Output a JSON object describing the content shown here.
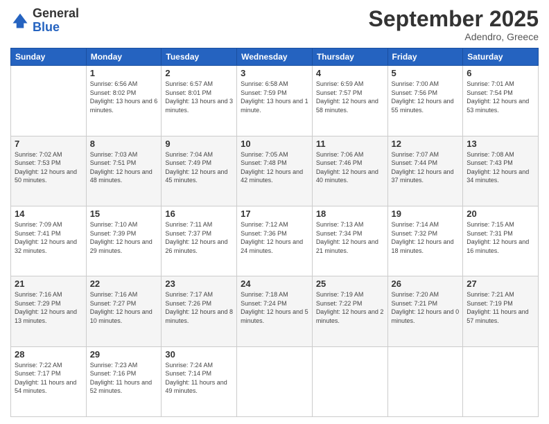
{
  "logo": {
    "general": "General",
    "blue": "Blue"
  },
  "header": {
    "month": "September 2025",
    "location": "Adendro, Greece"
  },
  "days_of_week": [
    "Sunday",
    "Monday",
    "Tuesday",
    "Wednesday",
    "Thursday",
    "Friday",
    "Saturday"
  ],
  "weeks": [
    [
      {
        "day": "",
        "sunrise": "",
        "sunset": "",
        "daylight": ""
      },
      {
        "day": "1",
        "sunrise": "Sunrise: 6:56 AM",
        "sunset": "Sunset: 8:02 PM",
        "daylight": "Daylight: 13 hours and 6 minutes."
      },
      {
        "day": "2",
        "sunrise": "Sunrise: 6:57 AM",
        "sunset": "Sunset: 8:01 PM",
        "daylight": "Daylight: 13 hours and 3 minutes."
      },
      {
        "day": "3",
        "sunrise": "Sunrise: 6:58 AM",
        "sunset": "Sunset: 7:59 PM",
        "daylight": "Daylight: 13 hours and 1 minute."
      },
      {
        "day": "4",
        "sunrise": "Sunrise: 6:59 AM",
        "sunset": "Sunset: 7:57 PM",
        "daylight": "Daylight: 12 hours and 58 minutes."
      },
      {
        "day": "5",
        "sunrise": "Sunrise: 7:00 AM",
        "sunset": "Sunset: 7:56 PM",
        "daylight": "Daylight: 12 hours and 55 minutes."
      },
      {
        "day": "6",
        "sunrise": "Sunrise: 7:01 AM",
        "sunset": "Sunset: 7:54 PM",
        "daylight": "Daylight: 12 hours and 53 minutes."
      }
    ],
    [
      {
        "day": "7",
        "sunrise": "Sunrise: 7:02 AM",
        "sunset": "Sunset: 7:53 PM",
        "daylight": "Daylight: 12 hours and 50 minutes."
      },
      {
        "day": "8",
        "sunrise": "Sunrise: 7:03 AM",
        "sunset": "Sunset: 7:51 PM",
        "daylight": "Daylight: 12 hours and 48 minutes."
      },
      {
        "day": "9",
        "sunrise": "Sunrise: 7:04 AM",
        "sunset": "Sunset: 7:49 PM",
        "daylight": "Daylight: 12 hours and 45 minutes."
      },
      {
        "day": "10",
        "sunrise": "Sunrise: 7:05 AM",
        "sunset": "Sunset: 7:48 PM",
        "daylight": "Daylight: 12 hours and 42 minutes."
      },
      {
        "day": "11",
        "sunrise": "Sunrise: 7:06 AM",
        "sunset": "Sunset: 7:46 PM",
        "daylight": "Daylight: 12 hours and 40 minutes."
      },
      {
        "day": "12",
        "sunrise": "Sunrise: 7:07 AM",
        "sunset": "Sunset: 7:44 PM",
        "daylight": "Daylight: 12 hours and 37 minutes."
      },
      {
        "day": "13",
        "sunrise": "Sunrise: 7:08 AM",
        "sunset": "Sunset: 7:43 PM",
        "daylight": "Daylight: 12 hours and 34 minutes."
      }
    ],
    [
      {
        "day": "14",
        "sunrise": "Sunrise: 7:09 AM",
        "sunset": "Sunset: 7:41 PM",
        "daylight": "Daylight: 12 hours and 32 minutes."
      },
      {
        "day": "15",
        "sunrise": "Sunrise: 7:10 AM",
        "sunset": "Sunset: 7:39 PM",
        "daylight": "Daylight: 12 hours and 29 minutes."
      },
      {
        "day": "16",
        "sunrise": "Sunrise: 7:11 AM",
        "sunset": "Sunset: 7:37 PM",
        "daylight": "Daylight: 12 hours and 26 minutes."
      },
      {
        "day": "17",
        "sunrise": "Sunrise: 7:12 AM",
        "sunset": "Sunset: 7:36 PM",
        "daylight": "Daylight: 12 hours and 24 minutes."
      },
      {
        "day": "18",
        "sunrise": "Sunrise: 7:13 AM",
        "sunset": "Sunset: 7:34 PM",
        "daylight": "Daylight: 12 hours and 21 minutes."
      },
      {
        "day": "19",
        "sunrise": "Sunrise: 7:14 AM",
        "sunset": "Sunset: 7:32 PM",
        "daylight": "Daylight: 12 hours and 18 minutes."
      },
      {
        "day": "20",
        "sunrise": "Sunrise: 7:15 AM",
        "sunset": "Sunset: 7:31 PM",
        "daylight": "Daylight: 12 hours and 16 minutes."
      }
    ],
    [
      {
        "day": "21",
        "sunrise": "Sunrise: 7:16 AM",
        "sunset": "Sunset: 7:29 PM",
        "daylight": "Daylight: 12 hours and 13 minutes."
      },
      {
        "day": "22",
        "sunrise": "Sunrise: 7:16 AM",
        "sunset": "Sunset: 7:27 PM",
        "daylight": "Daylight: 12 hours and 10 minutes."
      },
      {
        "day": "23",
        "sunrise": "Sunrise: 7:17 AM",
        "sunset": "Sunset: 7:26 PM",
        "daylight": "Daylight: 12 hours and 8 minutes."
      },
      {
        "day": "24",
        "sunrise": "Sunrise: 7:18 AM",
        "sunset": "Sunset: 7:24 PM",
        "daylight": "Daylight: 12 hours and 5 minutes."
      },
      {
        "day": "25",
        "sunrise": "Sunrise: 7:19 AM",
        "sunset": "Sunset: 7:22 PM",
        "daylight": "Daylight: 12 hours and 2 minutes."
      },
      {
        "day": "26",
        "sunrise": "Sunrise: 7:20 AM",
        "sunset": "Sunset: 7:21 PM",
        "daylight": "Daylight: 12 hours and 0 minutes."
      },
      {
        "day": "27",
        "sunrise": "Sunrise: 7:21 AM",
        "sunset": "Sunset: 7:19 PM",
        "daylight": "Daylight: 11 hours and 57 minutes."
      }
    ],
    [
      {
        "day": "28",
        "sunrise": "Sunrise: 7:22 AM",
        "sunset": "Sunset: 7:17 PM",
        "daylight": "Daylight: 11 hours and 54 minutes."
      },
      {
        "day": "29",
        "sunrise": "Sunrise: 7:23 AM",
        "sunset": "Sunset: 7:16 PM",
        "daylight": "Daylight: 11 hours and 52 minutes."
      },
      {
        "day": "30",
        "sunrise": "Sunrise: 7:24 AM",
        "sunset": "Sunset: 7:14 PM",
        "daylight": "Daylight: 11 hours and 49 minutes."
      },
      {
        "day": "",
        "sunrise": "",
        "sunset": "",
        "daylight": ""
      },
      {
        "day": "",
        "sunrise": "",
        "sunset": "",
        "daylight": ""
      },
      {
        "day": "",
        "sunrise": "",
        "sunset": "",
        "daylight": ""
      },
      {
        "day": "",
        "sunrise": "",
        "sunset": "",
        "daylight": ""
      }
    ]
  ]
}
